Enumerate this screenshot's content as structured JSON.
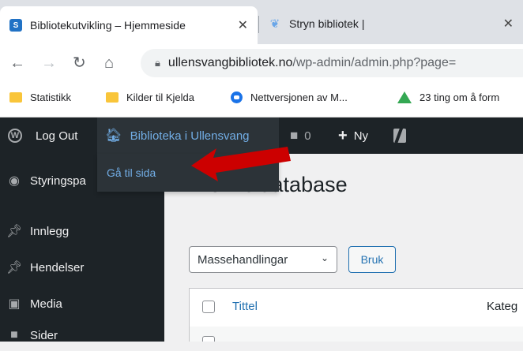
{
  "browser": {
    "tabs": [
      {
        "title": "Bibliotekutvikling – Hjemmeside",
        "favicon": "sharepoint-icon",
        "active": true
      },
      {
        "title": "Stryn bibliotek |",
        "favicon": "book-icon",
        "active": false
      }
    ],
    "close_glyph": "✕",
    "url_host": "ullensvangbibliotek.no",
    "url_path": "/wp-admin/admin.php?page="
  },
  "bookmarks": [
    {
      "label": "Statistikk",
      "icon": "folder-icon"
    },
    {
      "label": "Kilder til Kjelda",
      "icon": "folder-icon"
    },
    {
      "label": "Nettversjonen av M...",
      "icon": "globe-icon"
    },
    {
      "label": "23 ting om å form",
      "icon": "drive-icon"
    }
  ],
  "adminbar": {
    "logout": "Log Out",
    "site_name": "Biblioteka i Ullensvang",
    "comments_count": "0",
    "new_label": "Ny",
    "dropdown_item": "Gå til sida"
  },
  "sidebar": {
    "items": [
      {
        "label": "Styringspa",
        "icon": "dashboard-icon"
      },
      {
        "label": "Innlegg",
        "icon": "pin-icon"
      },
      {
        "label": "Hendelser",
        "icon": "pin-icon"
      },
      {
        "label": "Media",
        "icon": "media-icon"
      },
      {
        "label": "Sider",
        "icon": "page-icon"
      }
    ]
  },
  "main": {
    "page_title": "Artikkeldatabase",
    "bulk_actions": "Massehandlingar",
    "apply": "Bruk",
    "columns": {
      "title": "Tittel",
      "category": "Kateg"
    }
  },
  "colors": {
    "admin_bar": "#1d2327",
    "link": "#2271b1",
    "highlight": "#72aee6",
    "arrow": "#cc0000"
  }
}
